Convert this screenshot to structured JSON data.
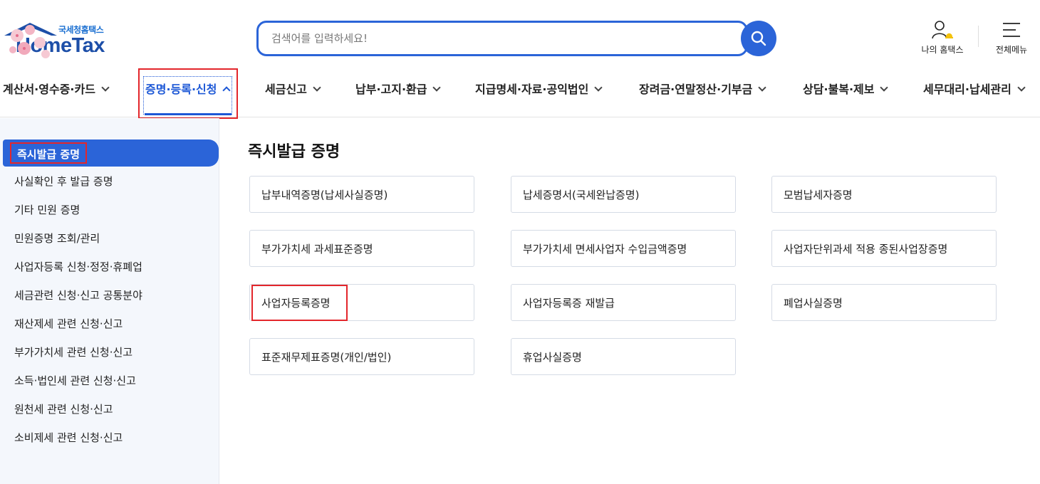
{
  "header": {
    "logo_sub": "국세청홈택스",
    "logo_main": "HomeTax",
    "search": {
      "placeholder": "검색어를 입력하세요!"
    },
    "utilities": [
      {
        "label": "나의 홈택스",
        "icon": "user-bell-icon"
      },
      {
        "label": "전체메뉴",
        "icon": "hamburger-menu-icon"
      }
    ]
  },
  "gnb": [
    {
      "label": "계산서·영수증·카드",
      "active": false
    },
    {
      "label": "증명·등록·신청",
      "active": true
    },
    {
      "label": "세금신고",
      "active": false
    },
    {
      "label": "납부·고지·환급",
      "active": false
    },
    {
      "label": "지급명세·자료·공익법인",
      "active": false
    },
    {
      "label": "장려금·연말정산·기부금",
      "active": false
    },
    {
      "label": "상담·불복·제보",
      "active": false
    },
    {
      "label": "세무대리·납세관리",
      "active": false
    }
  ],
  "sidebar": {
    "active": "즉시발급 증명",
    "items": [
      "사실확인 후 발급 증명",
      "기타 민원 증명",
      "민원증명 조회/관리",
      "사업자등록 신청·정정·휴폐업",
      "세금관련 신청·신고 공통분야",
      "재산제세 관련 신청·신고",
      "부가가치세 관련 신청·신고",
      "소득·법인세 관련 신청·신고",
      "원천세 관련 신청·신고",
      "소비제세 관련 신청·신고"
    ]
  },
  "main": {
    "title": "즉시발급 증명",
    "cards": [
      "납부내역증명(납세사실증명)",
      "납세증명서(국세완납증명)",
      "모범납세자증명",
      "부가가치세 과세표준증명",
      "부가가치세 면세사업자 수입금액증명",
      "사업자단위과세 적용 종된사업장증명",
      "사업자등록증명",
      "사업자등록증 재발급",
      "폐업사실증명",
      "표준재무제표증명(개인/법인)",
      "휴업사실증명"
    ]
  },
  "colors": {
    "accent": "#2b64d8",
    "highlight": "#e3262b",
    "sidebar_bg": "#f4f7fc"
  }
}
